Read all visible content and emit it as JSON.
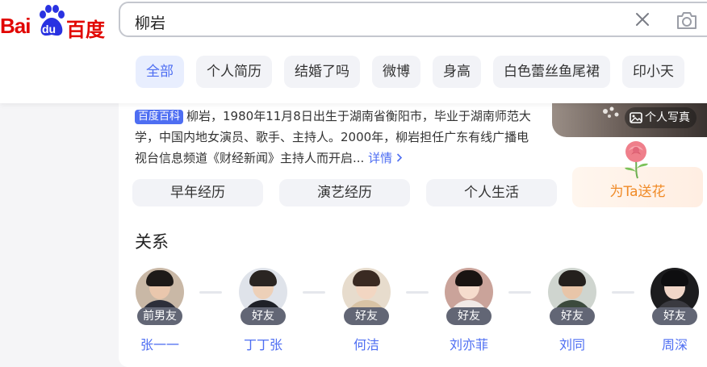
{
  "logo": {
    "latin": "Bai",
    "paw_text": "du",
    "chinese": "百度"
  },
  "search": {
    "query": "柳岩",
    "clear_icon": "close-icon",
    "camera_icon": "camera-icon"
  },
  "chips": [
    {
      "label": "全部",
      "active": true
    },
    {
      "label": "个人简历",
      "active": false
    },
    {
      "label": "结婚了吗",
      "active": false
    },
    {
      "label": "微博",
      "active": false
    },
    {
      "label": "身高",
      "active": false
    },
    {
      "label": "白色蕾丝鱼尾裙",
      "active": false
    },
    {
      "label": "印小天",
      "active": false
    }
  ],
  "card": {
    "photo_badge": "个人写真",
    "source_tag": "百度百科",
    "intro": "柳岩，1980年11月8日出生于湖南省衡阳市，毕业于湖南师范大学，中国内地女演员、歌手、主持人。2000年，柳岩担任广东有线广播电视台信息频道《财经新闻》主持人而开启...",
    "more_label": "详情",
    "buttons": [
      "早年经历",
      "演艺经历",
      "个人生活"
    ],
    "gift_label": "为Ta送花",
    "relations_title": "关系",
    "relations": [
      {
        "name": "张一一",
        "relation": "前男友"
      },
      {
        "name": "丁丁张",
        "relation": "好友"
      },
      {
        "name": "何洁",
        "relation": "好友"
      },
      {
        "name": "刘亦菲",
        "relation": "好友"
      },
      {
        "name": "刘同",
        "relation": "好友"
      },
      {
        "name": "周深",
        "relation": "好友"
      }
    ]
  },
  "colors": {
    "brand_red": "#e10601",
    "brand_blue": "#2932e1",
    "accent": "#4e6ef2",
    "gift_orange": "#f08a26"
  }
}
